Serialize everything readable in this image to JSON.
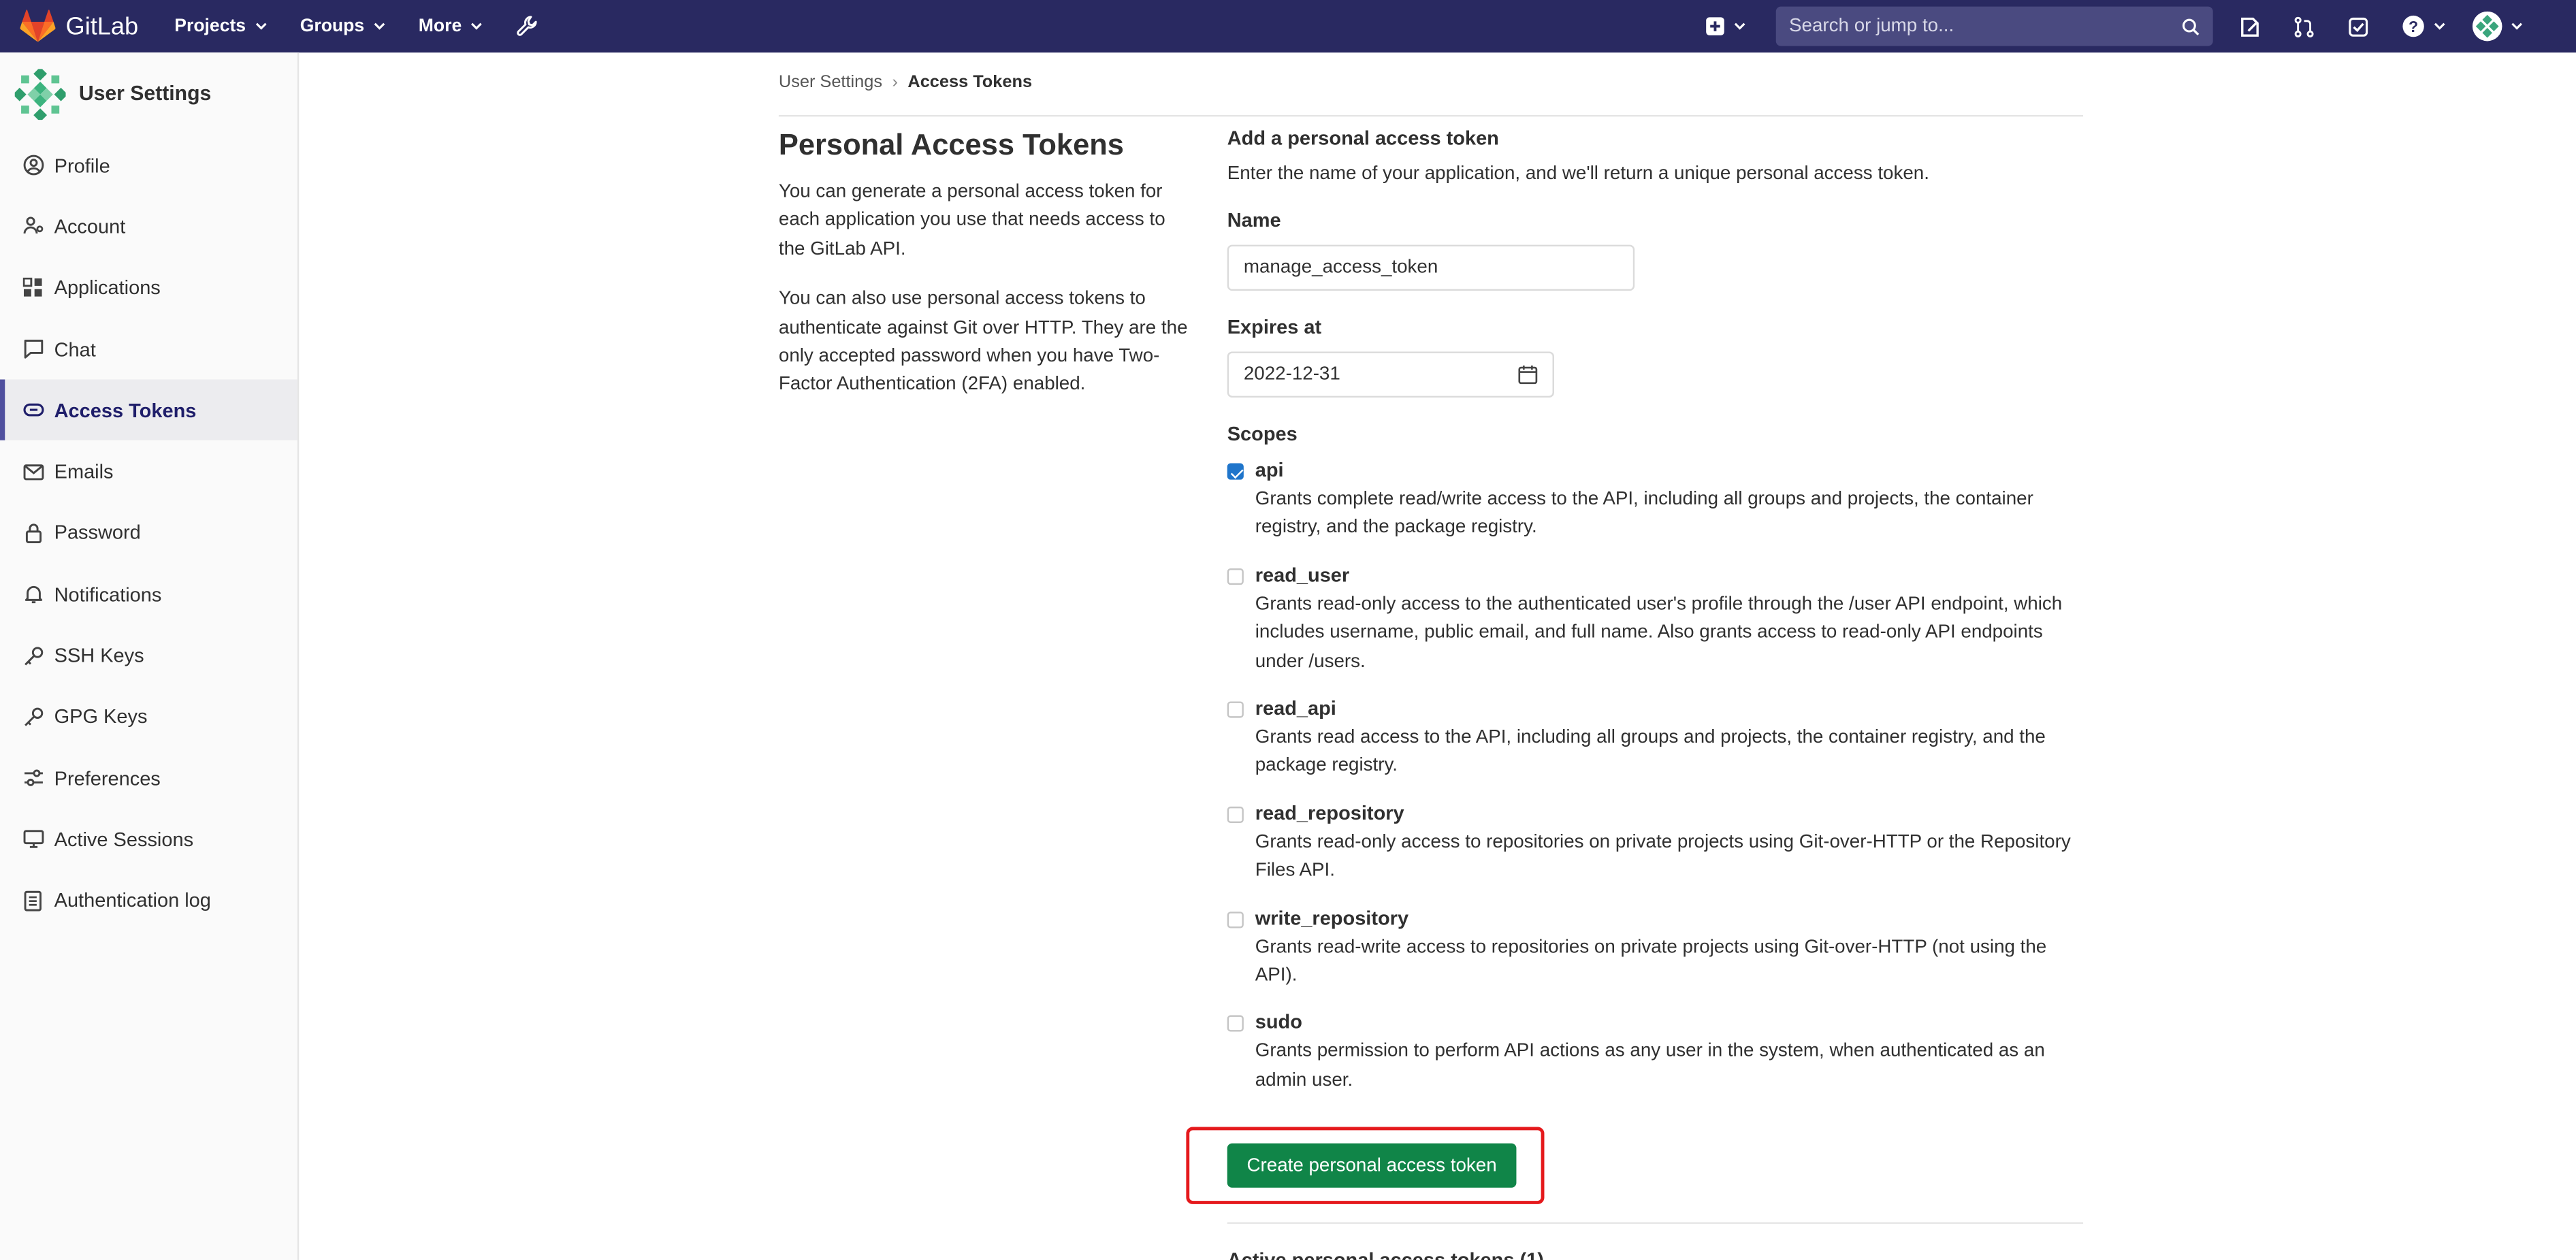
{
  "navbar": {
    "brand": "GitLab",
    "menu": [
      {
        "label": "Projects",
        "name": "nav-projects"
      },
      {
        "label": "Groups",
        "name": "nav-groups"
      },
      {
        "label": "More",
        "name": "nav-more"
      }
    ],
    "search_placeholder": "Search or jump to...",
    "icons": [
      "plus-square-icon",
      "search-icon",
      "issues-icon",
      "merge-request-icon",
      "todo-icon",
      "help-icon",
      "avatar"
    ]
  },
  "sidebar": {
    "title": "User Settings",
    "items": [
      {
        "label": "Profile",
        "icon": "profile-icon"
      },
      {
        "label": "Account",
        "icon": "account-icon"
      },
      {
        "label": "Applications",
        "icon": "applications-icon"
      },
      {
        "label": "Chat",
        "icon": "chat-icon"
      },
      {
        "label": "Access Tokens",
        "icon": "token-icon",
        "active": true
      },
      {
        "label": "Emails",
        "icon": "mail-icon"
      },
      {
        "label": "Password",
        "icon": "lock-icon"
      },
      {
        "label": "Notifications",
        "icon": "bell-icon"
      },
      {
        "label": "SSH Keys",
        "icon": "key-icon"
      },
      {
        "label": "GPG Keys",
        "icon": "key-icon"
      },
      {
        "label": "Preferences",
        "icon": "preferences-icon"
      },
      {
        "label": "Active Sessions",
        "icon": "monitor-icon"
      },
      {
        "label": "Authentication log",
        "icon": "log-icon"
      }
    ]
  },
  "breadcrumb": {
    "parent": "User Settings",
    "current": "Access Tokens"
  },
  "intro": {
    "title": "Personal Access Tokens",
    "p1": "You can generate a personal access token for each application you use that needs access to the GitLab API.",
    "p2": "You can also use personal access tokens to authenticate against Git over HTTP. They are the only accepted password when you have Two-Factor Authentication (2FA) enabled."
  },
  "form": {
    "heading": "Add a personal access token",
    "description": "Enter the name of your application, and we'll return a unique personal access token.",
    "name_label": "Name",
    "name_value": "manage_access_token",
    "expires_label": "Expires at",
    "expires_value": "2022-12-31",
    "scopes_label": "Scopes",
    "scopes": [
      {
        "name": "api",
        "checked": true,
        "description": "Grants complete read/write access to the API, including all groups and projects, the container registry, and the package registry."
      },
      {
        "name": "read_user",
        "checked": false,
        "description": "Grants read-only access to the authenticated user's profile through the /user API endpoint, which includes username, public email, and full name. Also grants access to read-only API endpoints under /users."
      },
      {
        "name": "read_api",
        "checked": false,
        "description": "Grants read access to the API, including all groups and projects, the container registry, and the package registry."
      },
      {
        "name": "read_repository",
        "checked": false,
        "description": "Grants read-only access to repositories on private projects using Git-over-HTTP or the Repository Files API."
      },
      {
        "name": "write_repository",
        "checked": false,
        "description": "Grants read-write access to repositories on private projects using Git-over-HTTP (not using the API)."
      },
      {
        "name": "sudo",
        "checked": false,
        "description": "Grants permission to perform API actions as any user in the system, when authenticated as an admin user."
      }
    ],
    "submit_label": "Create personal access token",
    "next_section_partial": "Active personal access tokens (1)"
  },
  "colors": {
    "navbar": "#292961",
    "primary_button": "#108548",
    "highlight": "#e5191c",
    "checkbox": "#1f75cb"
  }
}
